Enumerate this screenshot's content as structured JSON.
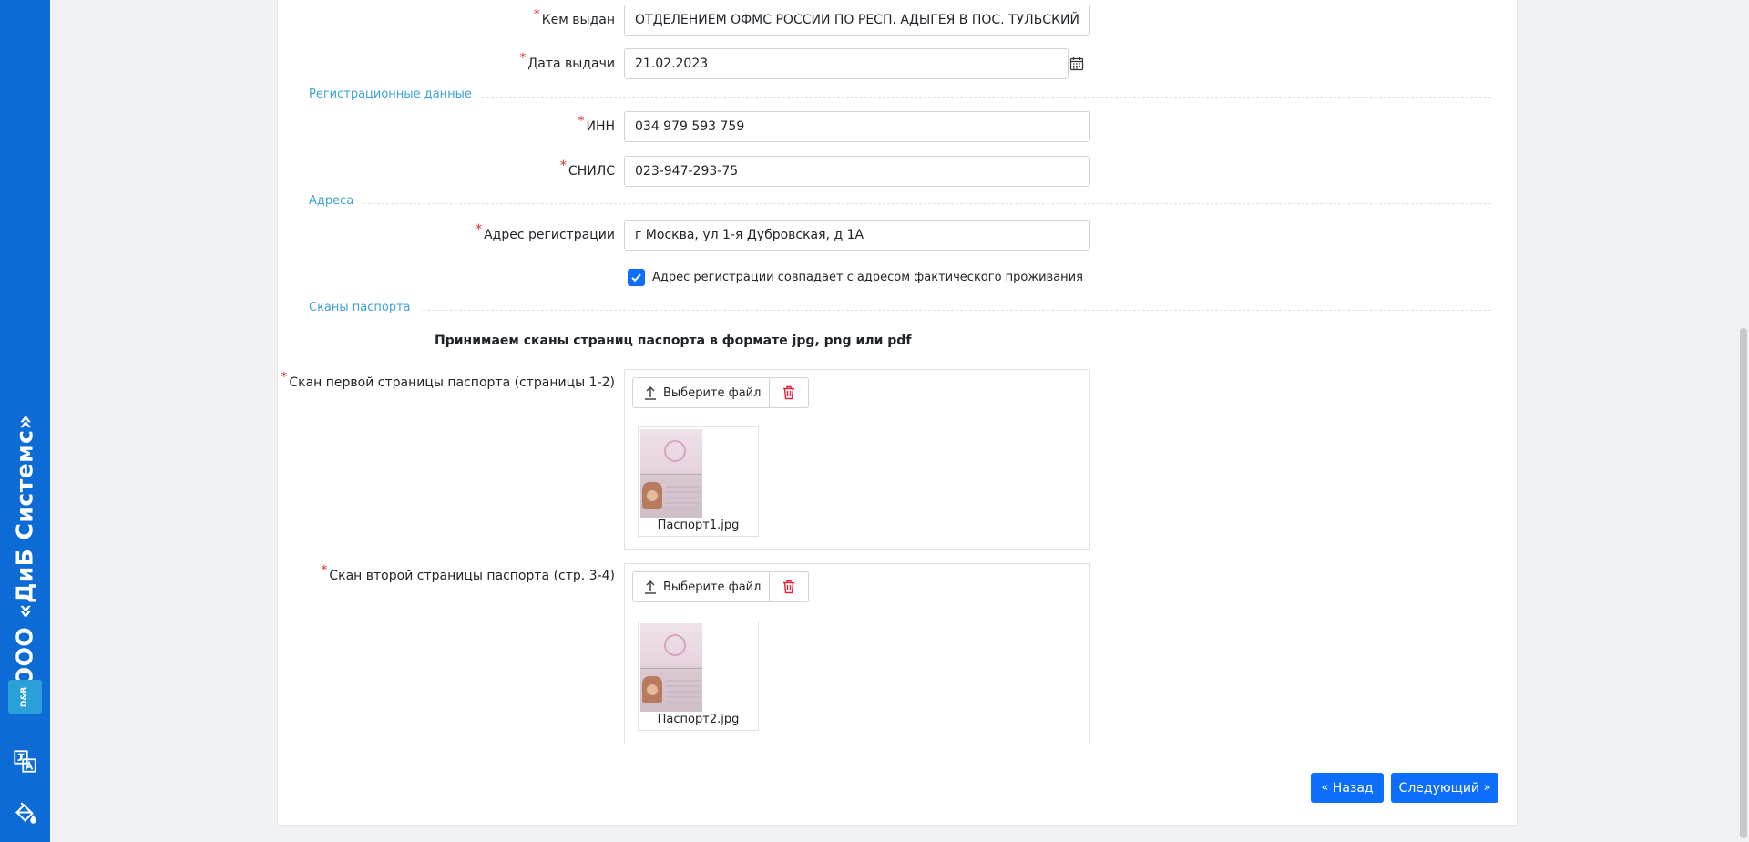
{
  "sidebar": {
    "brand": "ООО «ДиБ Системс»",
    "logo_text": "D&B"
  },
  "form": {
    "issued_by": {
      "label": "Кем выдан",
      "value": "ОТДЕЛЕНИЕМ ОФМС РОССИИ ПО РЕСП. АДЫГЕЯ В ПОС. ТУЛЬСКИЙ"
    },
    "issue_date": {
      "label": "Дата выдачи",
      "value": "21.02.2023"
    },
    "section_registration": "Регистрационные данные",
    "inn": {
      "label": "ИНН",
      "value": "034 979 593 759"
    },
    "snils": {
      "label": "СНИЛС",
      "value": "023-947-293-75"
    },
    "section_addresses": "Адреса",
    "reg_address": {
      "label": "Адрес регистрации",
      "value": "г Москва, ул 1-я Дубровская, д 1А"
    },
    "same_address": {
      "label": "Адрес регистрации совпадает с адресом фактического проживания",
      "checked": true
    },
    "section_scans": "Сканы паспорта",
    "scans_note": "Принимаем сканы страниц паспорта в формате jpg, png или pdf",
    "scan1": {
      "label": "Скан первой страницы паспорта (страницы 1-2)",
      "button": "Выберите файл",
      "filename": "Паспорт1.jpg"
    },
    "scan2": {
      "label": "Скан второй страницы паспорта (стр. 3-4)",
      "button": "Выберите файл",
      "filename": "Паспорт2.jpg"
    }
  },
  "footer": {
    "back": "Назад",
    "next": "Следующий"
  },
  "colors": {
    "sidebar": "#0d6bd6",
    "primary": "#0d6efd",
    "section_title": "#3ea3d1",
    "required": "#e0242b",
    "delete": "#e0243a"
  }
}
